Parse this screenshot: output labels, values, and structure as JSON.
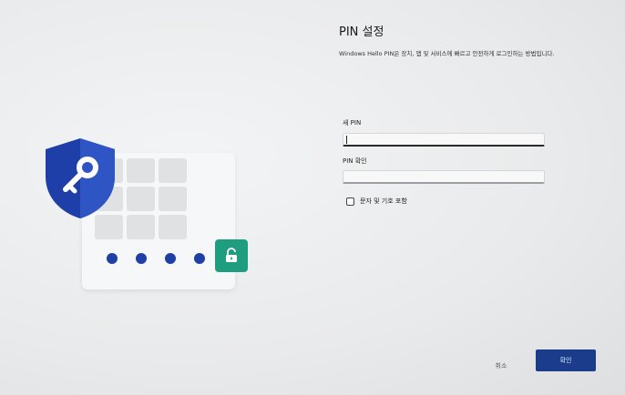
{
  "dialog": {
    "title": "PIN 설정",
    "description": "Windows Hello PIN은 장치, 앱 및 서비스에 빠르고 안전하게 로그인하는 방법입니다."
  },
  "form": {
    "new_pin_label": "새 PIN",
    "new_pin_value": "",
    "confirm_pin_label": "PIN 확인",
    "confirm_pin_value": "",
    "include_chars_label": "문자 및 기호 포함",
    "include_chars_checked": false
  },
  "buttons": {
    "cancel_label": "취소",
    "ok_label": "확인"
  },
  "illustration": {
    "shield_icon": "key-shield-icon",
    "lock_icon": "unlocked-padlock-icon",
    "pin_dot_count": 4,
    "colors": {
      "shield": "#1e3fa8",
      "dots": "#1d3fa6",
      "lock_badge": "#1f9e7f",
      "primary_button": "#1a3c8a"
    }
  }
}
